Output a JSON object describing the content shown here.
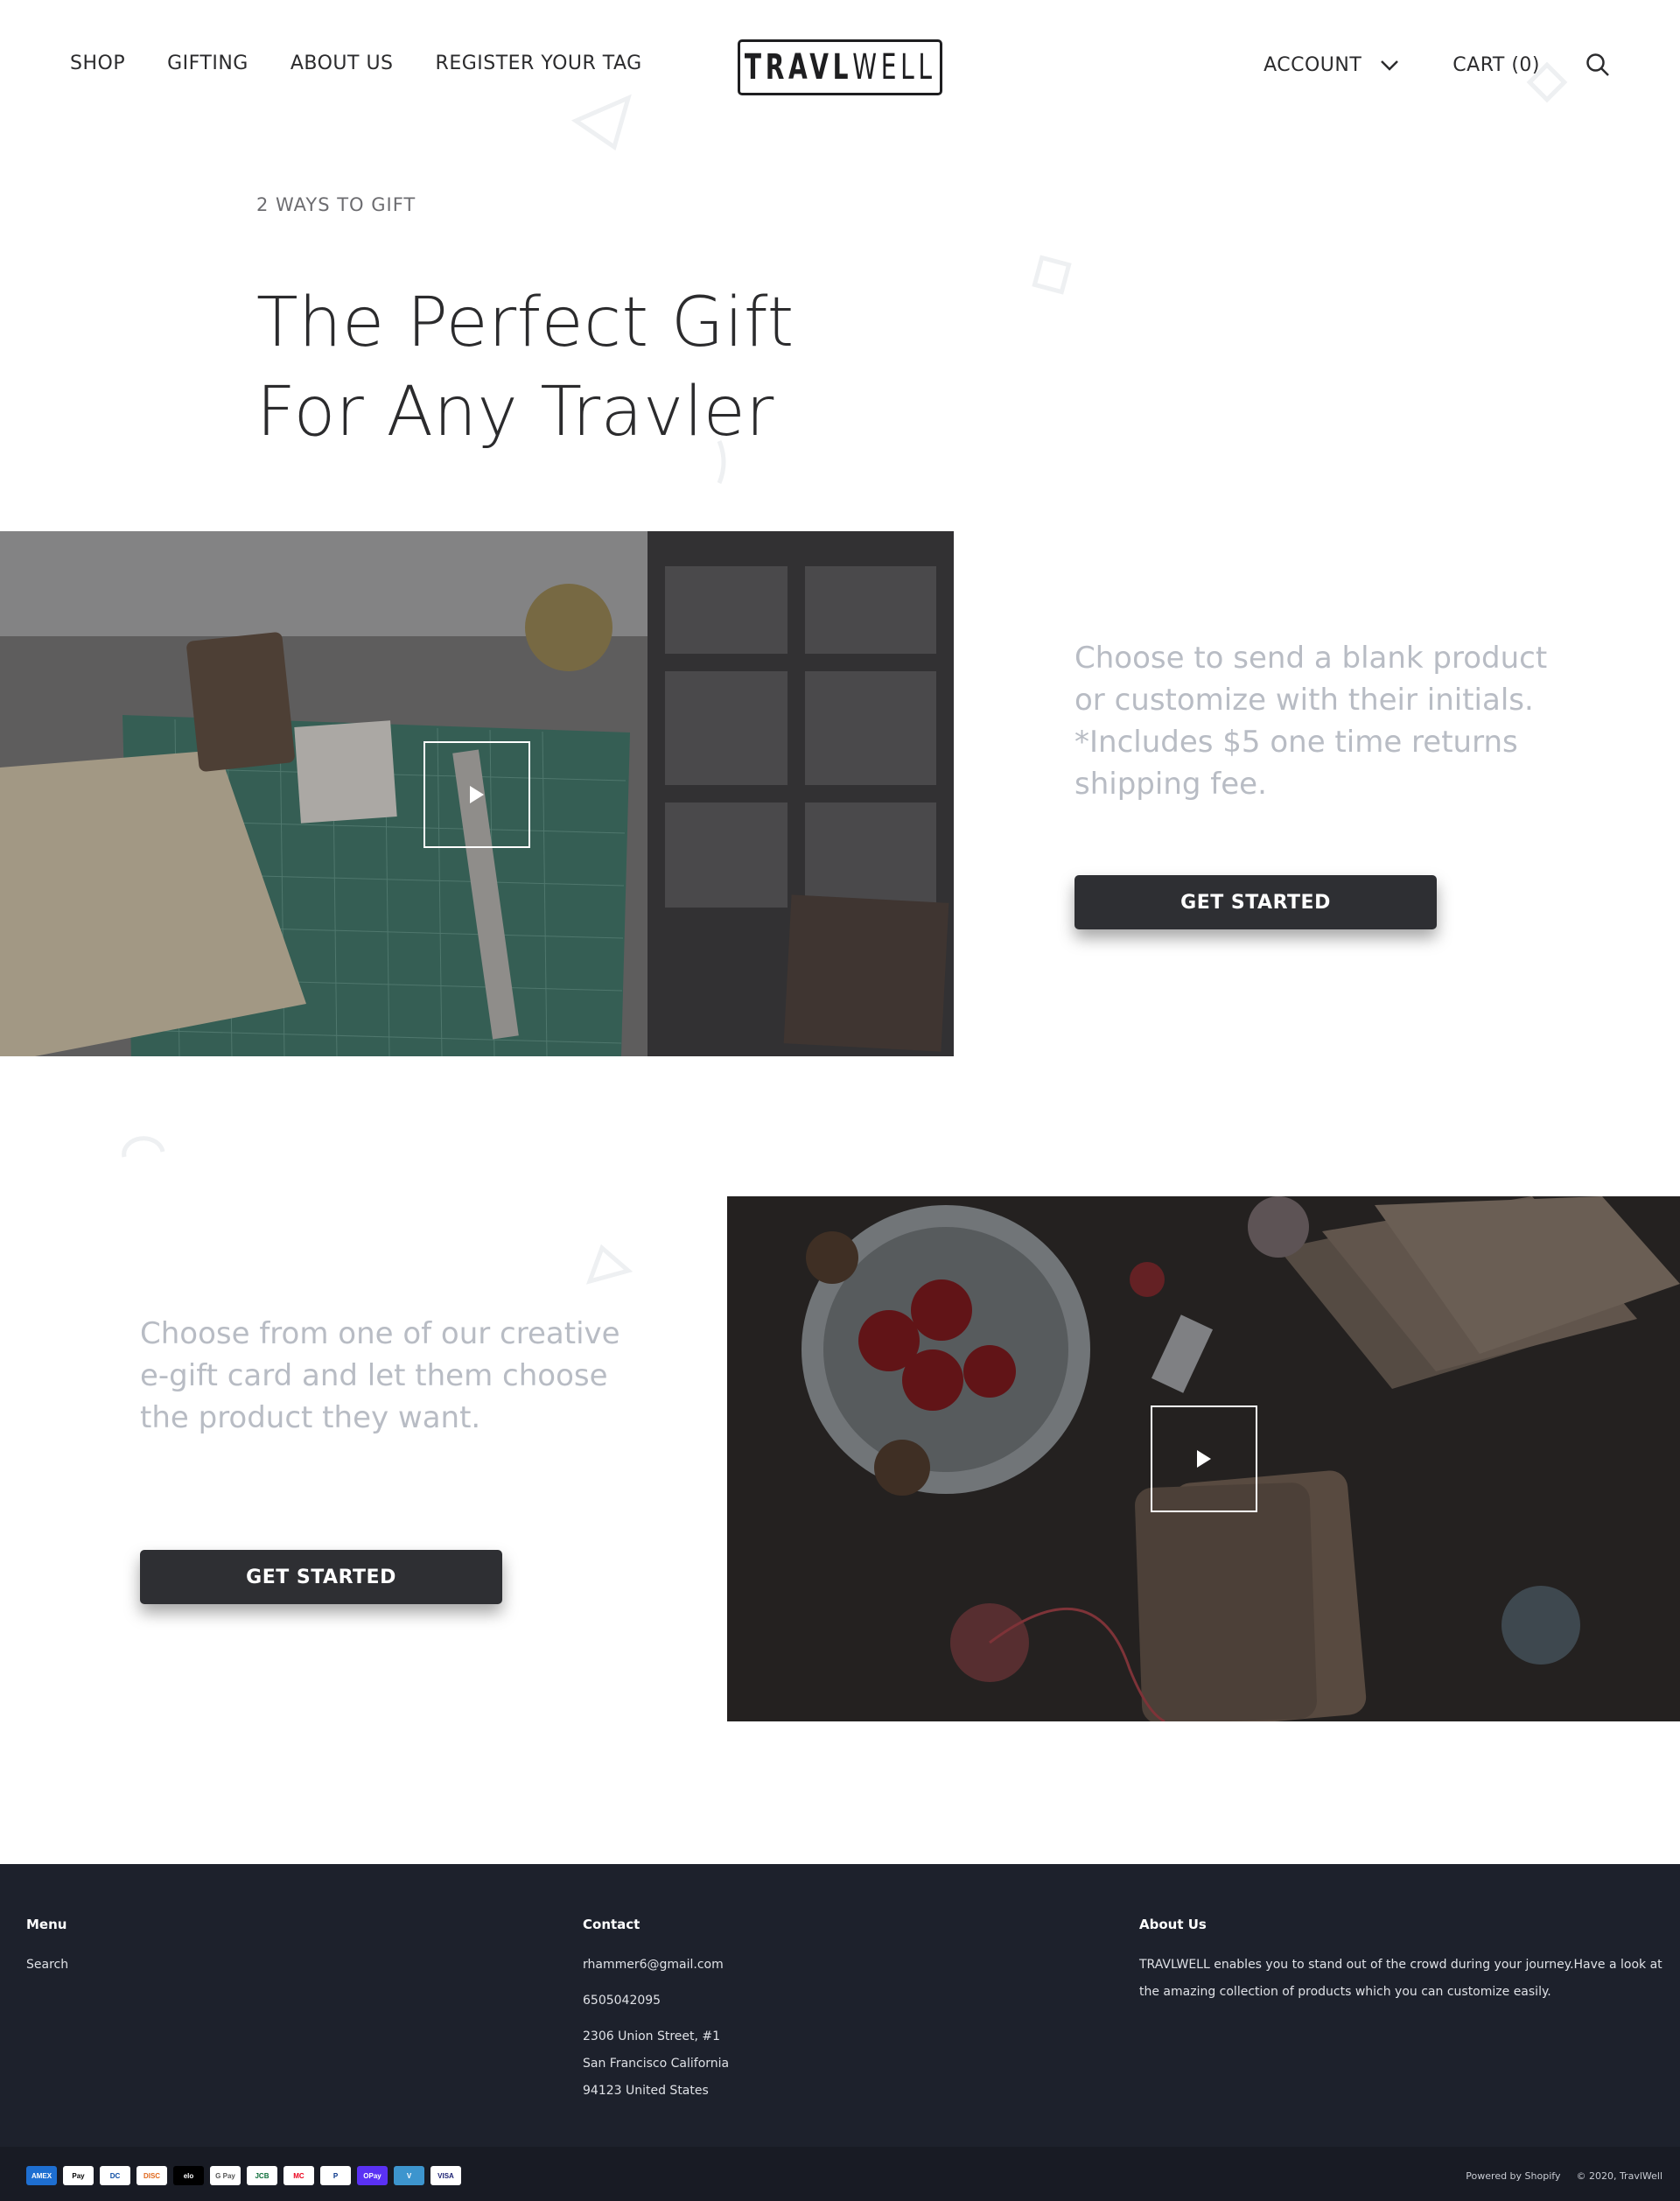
{
  "header": {
    "nav_left": [
      "SHOP",
      "GIFTING",
      "ABOUT US",
      "REGISTER YOUR TAG"
    ],
    "logo_bold": "TRAVL",
    "logo_light": "WELL",
    "account_label": "ACCOUNT",
    "cart_label": "CART (0)",
    "icons": {
      "search": "search-icon",
      "account_dropdown": "chevron-down-icon"
    }
  },
  "hero": {
    "eyebrow": "2 WAYS TO GIFT",
    "title_line1": "The Perfect Gift",
    "title_line2": "For Any Travler"
  },
  "gift_blocks": [
    {
      "text": "Choose to send a blank product or customize with their initials. *Includes $5 one time returns shipping fee.",
      "button_label": "GET STARTED",
      "video_icon": "play-icon"
    },
    {
      "text": "Choose from one of our creative e-gift card and let them choose the product they want.",
      "button_label": "GET STARTED",
      "video_icon": "play-icon"
    }
  ],
  "footer": {
    "menu": {
      "heading": "Menu",
      "items": [
        "Search"
      ]
    },
    "contact": {
      "heading": "Contact",
      "email": "rhammer6@gmail.com",
      "phone": "6505042095",
      "address_line1": "2306 Union Street, #1",
      "address_line2": "San Francisco California",
      "address_line3": "94123 United States"
    },
    "about": {
      "heading": "About Us",
      "text": "TRAVLWELL enables you to stand out of the crowd during your journey.Have a look at the amazing collection of products which you can customize easily."
    },
    "payment_methods": [
      "AMEX",
      "Pay",
      "DC",
      "DISC",
      "elo",
      "G Pay",
      "JCB",
      "MC",
      "P",
      "OPay",
      "V",
      "VISA"
    ],
    "powered_by": "Powered by Shopify",
    "copyright": "© 2020, TravlWell"
  },
  "colors": {
    "text_dark": "#2b2b2d",
    "muted_text": "#b8bcc4",
    "button_bg": "#2e2f33",
    "footer_bg": "#1d212c"
  }
}
